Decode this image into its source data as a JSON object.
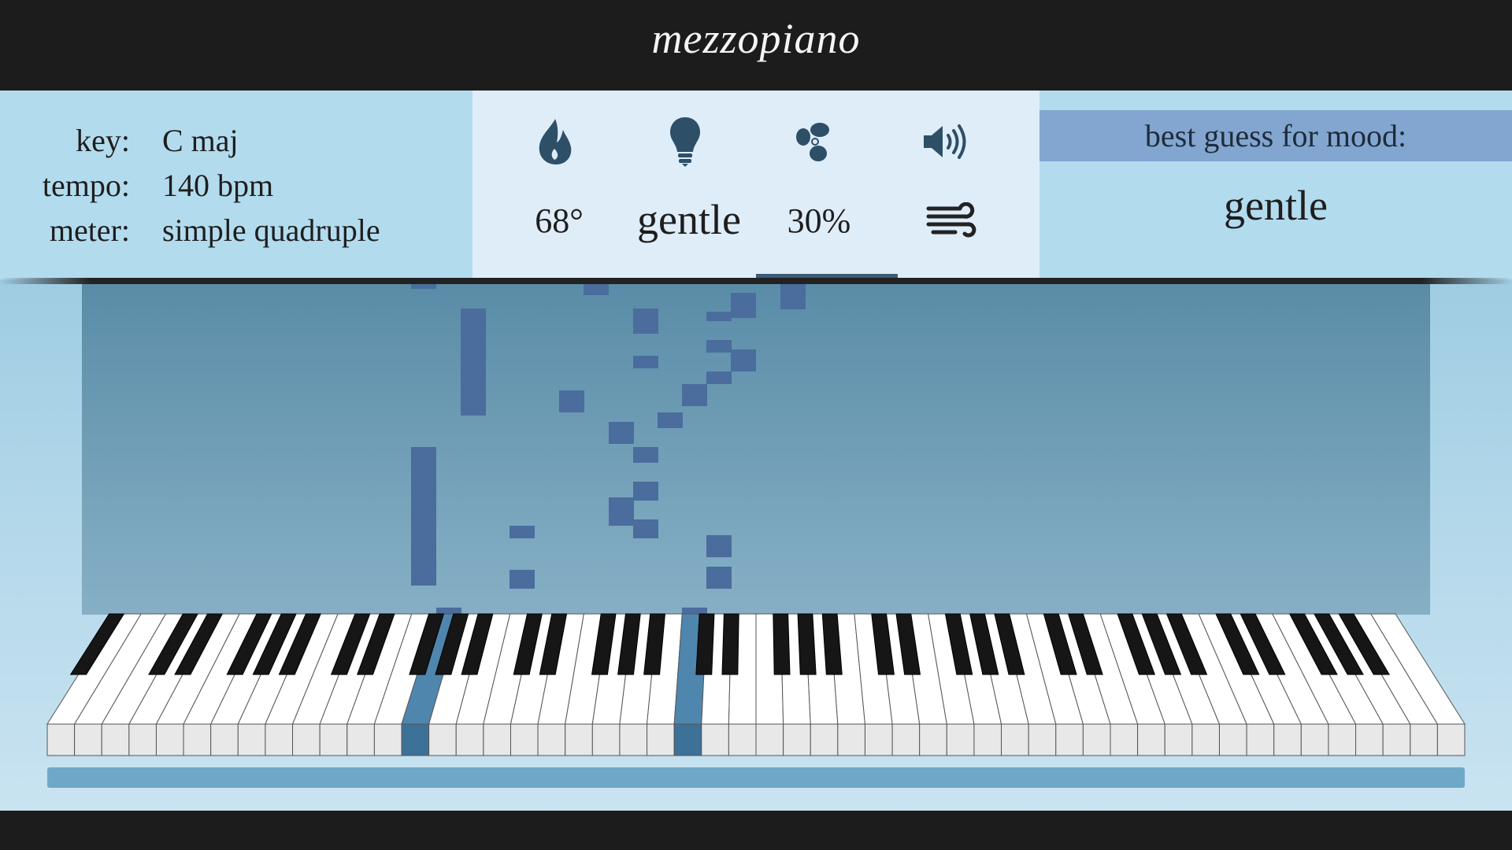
{
  "app": {
    "title": "mezzopiano"
  },
  "info": {
    "rows": [
      {
        "label": "key:",
        "value": "C maj"
      },
      {
        "label": "tempo:",
        "value": "140 bpm"
      },
      {
        "label": "meter:",
        "value": "simple quadruple"
      }
    ]
  },
  "controls": {
    "temperature": {
      "icon": "flame-icon",
      "value": "68°"
    },
    "light": {
      "icon": "lightbulb-icon",
      "value": "gentle"
    },
    "fan": {
      "icon": "fan-icon",
      "value": "30%"
    },
    "sound": {
      "icon": "speaker-icon",
      "value_icon": "wind-icon"
    }
  },
  "mood": {
    "heading": "best guess for mood:",
    "value": "gentle"
  },
  "keyboard": {
    "white_key_count": 52,
    "highlighted_white_keys": [
      13,
      23
    ],
    "highlight_color": "#4f86ad"
  },
  "colors": {
    "header": "#1c1c1c",
    "panel_side": "#b3dbee",
    "panel_middle": "#dfedf9",
    "mood_header": "#82a6d0",
    "note": "#4a6d9d",
    "icon": "#2d4f68"
  }
}
